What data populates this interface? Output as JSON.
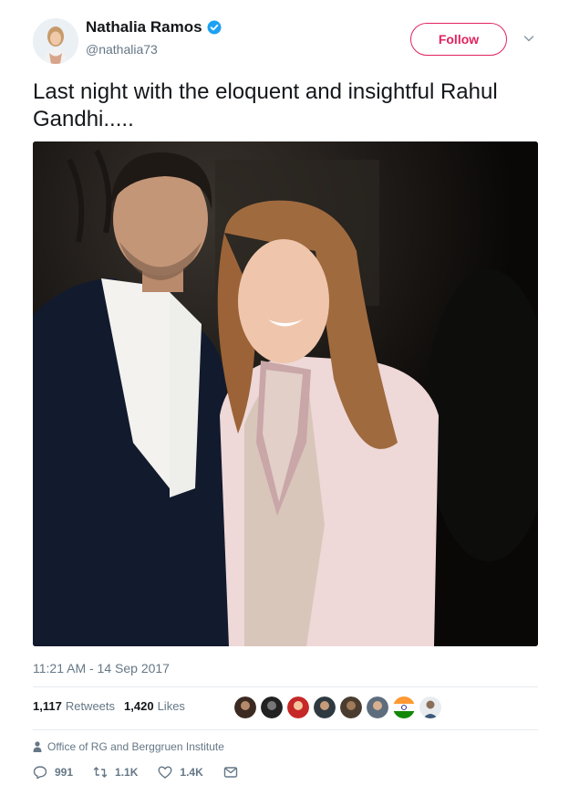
{
  "user": {
    "name": "Nathalia Ramos",
    "handle": "@nathalia73",
    "verified": true,
    "follow_label": "Follow"
  },
  "tweet": {
    "text": "Last night with the eloquent and insightful Rahul Gandhi.....",
    "timestamp": "11:21 AM - 14 Sep 2017",
    "location": "Office of RG and Berggruen Institute"
  },
  "stats": {
    "retweets_count": "1,117",
    "retweets_label": "Retweets",
    "likes_count": "1,420",
    "likes_label": "Likes"
  },
  "actions": {
    "reply_count": "991",
    "retweet_count": "1.1K",
    "like_count": "1.4K"
  },
  "colors": {
    "follow": "#e0245e",
    "verified": "#1da1f2",
    "secondary_text": "#657786"
  },
  "icons": [
    "verified-icon",
    "chevron-down-icon",
    "location-icon",
    "reply-icon",
    "retweet-icon",
    "like-icon",
    "message-icon"
  ]
}
